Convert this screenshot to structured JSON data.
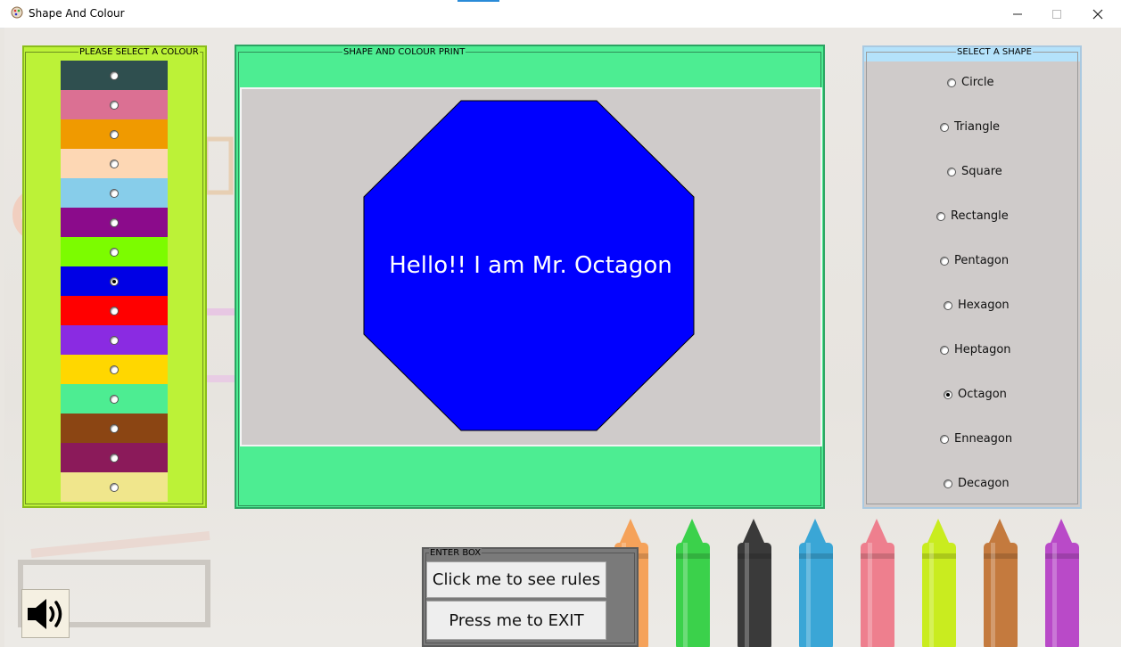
{
  "window": {
    "title": "Shape And Colour",
    "app_icon": "app-icon",
    "controls": {
      "minimize": "─",
      "maximize": "☐",
      "close": "✕"
    }
  },
  "colour_panel": {
    "label": "PLEASE SELECT A COLOUR",
    "swatches": [
      {
        "color": "#2f4f4f",
        "selected": false
      },
      {
        "color": "#db7093",
        "selected": false
      },
      {
        "color": "#f09a00",
        "selected": false
      },
      {
        "color": "#fdd7b4",
        "selected": false
      },
      {
        "color": "#87cdea",
        "selected": false
      },
      {
        "color": "#8b0b8b",
        "selected": false
      },
      {
        "color": "#7cfc00",
        "selected": false
      },
      {
        "color": "#0000e5",
        "selected": true
      },
      {
        "color": "#ff0000",
        "selected": false
      },
      {
        "color": "#8a2be2",
        "selected": false
      },
      {
        "color": "#ffd700",
        "selected": false
      },
      {
        "color": "#4ded92",
        "selected": false
      },
      {
        "color": "#8b4513",
        "selected": false
      },
      {
        "color": "#8b1a5a",
        "selected": false
      },
      {
        "color": "#f0e68c",
        "selected": false
      }
    ]
  },
  "print_panel": {
    "label": "SHAPE AND COLOUR PRINT",
    "shape_fill": "#0000ff",
    "message": "Hello!! I am Mr. Octagon"
  },
  "shape_panel": {
    "label": "SELECT A SHAPE",
    "options": [
      {
        "label": "Circle",
        "selected": false
      },
      {
        "label": "Triangle",
        "selected": false
      },
      {
        "label": "Square",
        "selected": false
      },
      {
        "label": "Rectangle",
        "selected": false
      },
      {
        "label": "Pentagon",
        "selected": false
      },
      {
        "label": "Hexagon",
        "selected": false
      },
      {
        "label": "Heptagon",
        "selected": false
      },
      {
        "label": "Octagon",
        "selected": true
      },
      {
        "label": "Enneagon",
        "selected": false
      },
      {
        "label": "Decagon",
        "selected": false
      }
    ]
  },
  "enter_box": {
    "label": "ENTER BOX",
    "rules_button": "Click me to see rules",
    "exit_button": "Press me to EXIT"
  },
  "sound_button": {
    "icon": "speaker-icon"
  },
  "crayons": [
    "#f5a25a",
    "#3bd14b",
    "#3a3a3a",
    "#3aa6d6",
    "#ee7f8e",
    "#c9ec1f",
    "#c47a3e",
    "#b94ac8"
  ]
}
